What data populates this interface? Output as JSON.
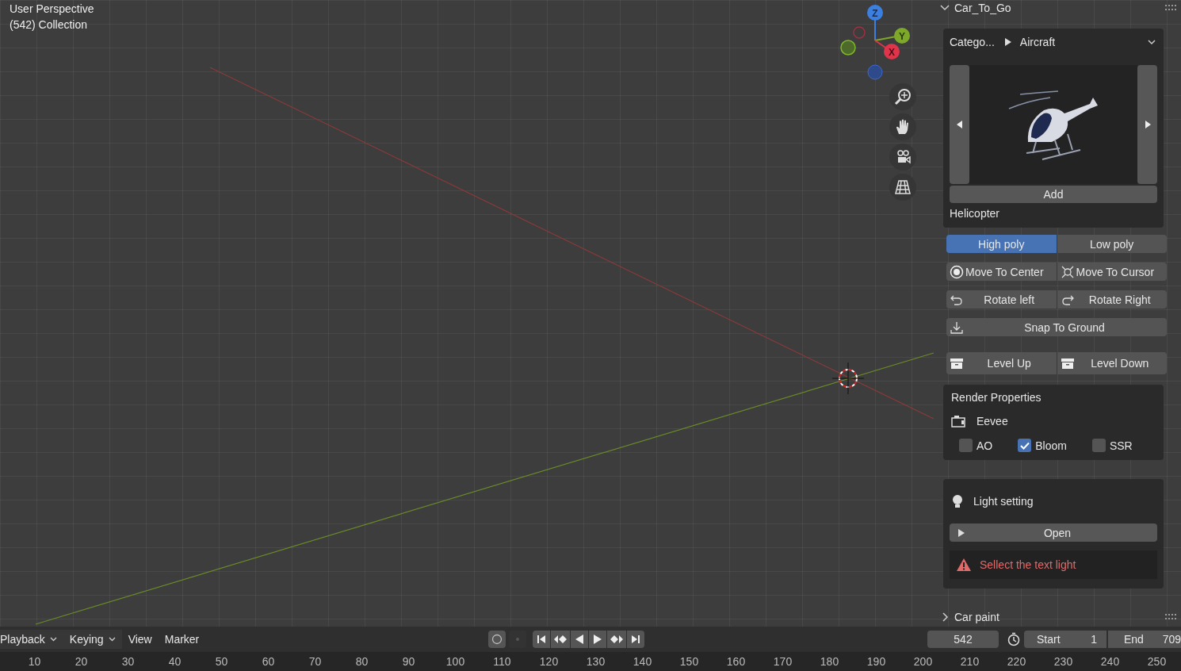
{
  "viewport": {
    "title": "User Perspective",
    "collection": "(542) Collection",
    "gizmo_axes": [
      "Z",
      "Y",
      "X"
    ]
  },
  "panel": {
    "title": "Car_To_Go",
    "expanded": true,
    "category_label": "Catego...",
    "category": "Aircraft",
    "add_button": "Add",
    "asset_name": "Helicopter",
    "poly_options": [
      {
        "label": "High poly",
        "selected": true
      },
      {
        "label": "Low poly",
        "selected": false
      }
    ],
    "button_rows": [
      [
        {
          "label": "Move To Center",
          "kind": "target"
        },
        {
          "label": "Move To Cursor",
          "kind": "cursor"
        }
      ],
      [
        {
          "label": "Rotate left",
          "kind": "rotate-left"
        },
        {
          "label": "Rotate Right",
          "kind": "rotate-right"
        }
      ],
      [
        {
          "label": "Snap To Ground",
          "kind": "snap"
        }
      ],
      [
        {
          "label": "Level Up",
          "kind": "box"
        },
        {
          "label": "Level Down",
          "kind": "box"
        }
      ]
    ],
    "render": {
      "title": "Render Properties",
      "engine": "Eevee",
      "options": [
        {
          "label": "AO",
          "checked": false
        },
        {
          "label": "Bloom",
          "checked": true
        },
        {
          "label": "SSR",
          "checked": false
        }
      ]
    },
    "light": {
      "title": "Light setting",
      "button": "Open",
      "warning": "Sellect the text light"
    }
  },
  "collapsed_panel": {
    "title": "Car paint",
    "expanded": false
  },
  "timeline": {
    "menus": [
      {
        "label": "Playback",
        "dropdown": true
      },
      {
        "label": "Keying",
        "dropdown": true
      },
      {
        "label": "View",
        "dropdown": false
      },
      {
        "label": "Marker",
        "dropdown": false
      }
    ],
    "current_frame": "542",
    "start": {
      "label": "Start",
      "value": "1"
    },
    "end": {
      "label": "End",
      "value": "709"
    },
    "ruler": [
      "10",
      "20",
      "30",
      "40",
      "50",
      "60",
      "70",
      "80",
      "90",
      "100",
      "110",
      "120",
      "130",
      "140",
      "150",
      "160",
      "170",
      "180",
      "190",
      "200",
      "210",
      "220",
      "230",
      "240",
      "250"
    ]
  }
}
